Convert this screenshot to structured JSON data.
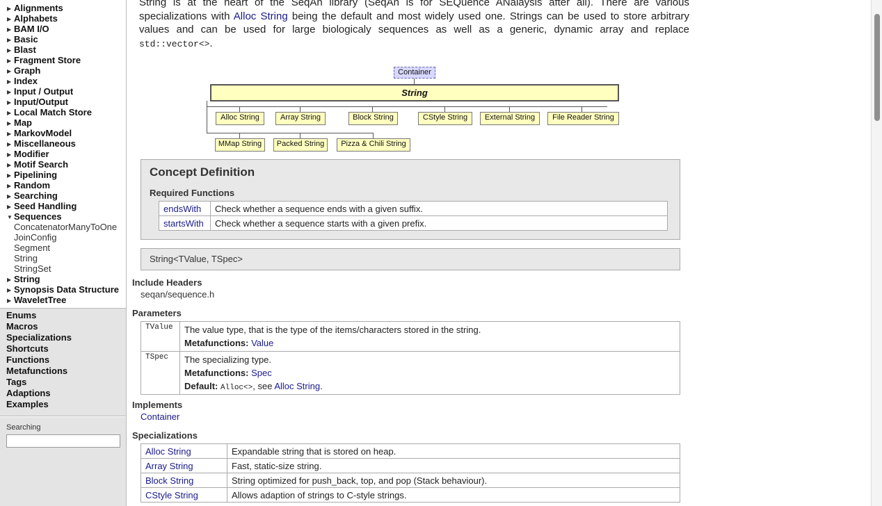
{
  "sidebar": {
    "tree": [
      {
        "label": "Alignments",
        "type": "group"
      },
      {
        "label": "Alphabets",
        "type": "group"
      },
      {
        "label": "BAM I/O",
        "type": "group"
      },
      {
        "label": "Basic",
        "type": "group"
      },
      {
        "label": "Blast",
        "type": "group"
      },
      {
        "label": "Fragment Store",
        "type": "group"
      },
      {
        "label": "Graph",
        "type": "group"
      },
      {
        "label": "Index",
        "type": "group"
      },
      {
        "label": "Input / Output",
        "type": "group"
      },
      {
        "label": "Input/Output",
        "type": "group"
      },
      {
        "label": "Local Match Store",
        "type": "group"
      },
      {
        "label": "Map",
        "type": "group"
      },
      {
        "label": "MarkovModel",
        "type": "group"
      },
      {
        "label": "Miscellaneous",
        "type": "group"
      },
      {
        "label": "Modifier",
        "type": "group"
      },
      {
        "label": "Motif Search",
        "type": "group"
      },
      {
        "label": "Pipelining",
        "type": "group"
      },
      {
        "label": "Random",
        "type": "group"
      },
      {
        "label": "Searching",
        "type": "group"
      },
      {
        "label": "Seed Handling",
        "type": "group"
      },
      {
        "label": "Sequences",
        "type": "group-open"
      },
      {
        "label": "ConcatenatorManyToOne",
        "type": "sub"
      },
      {
        "label": "JoinConfig",
        "type": "sub"
      },
      {
        "label": "Segment",
        "type": "sub"
      },
      {
        "label": "String",
        "type": "sub"
      },
      {
        "label": "StringSet",
        "type": "sub"
      },
      {
        "label": "String",
        "type": "group"
      },
      {
        "label": "Synopsis Data Structure",
        "type": "group"
      },
      {
        "label": "WaveletTree",
        "type": "group"
      }
    ],
    "categories": [
      "Enums",
      "Macros",
      "Specializations",
      "Shortcuts",
      "Functions",
      "Metafunctions",
      "Tags",
      "Adaptions",
      "Examples"
    ],
    "search": {
      "label": "Searching",
      "value": ""
    }
  },
  "intro": {
    "p1": "String is at the heart of the SeqAn library (SeqAn is for SEQuence ANalaysis after all). There are various specializations with ",
    "link": "Alloc String",
    "p2": " being the default and most widely used one. Strings can be used to store arbitrary values and can be used for large biologicaly sequences as well as a generic, dynamic array and replace ",
    "code": "std::vector<>",
    "p3": "."
  },
  "diagram": {
    "container": "Container",
    "root": "String",
    "row1": [
      "Alloc String",
      "Array String",
      "Block String",
      "CStyle String",
      "External String",
      "File Reader String"
    ],
    "row2": [
      "MMap String",
      "Packed String",
      "Pizza & Chili String"
    ]
  },
  "concept": {
    "title": "Concept Definition",
    "required_title": "Required Functions",
    "functions": [
      {
        "name": "endsWith",
        "desc": "Check whether a sequence ends with a given suffix."
      },
      {
        "name": "startsWith",
        "desc": "Check whether a sequence starts with a given prefix."
      }
    ]
  },
  "signature": "String<TValue, TSpec>",
  "include": {
    "title": "Include Headers",
    "value": "seqan/sequence.h"
  },
  "parameters": {
    "title": "Parameters",
    "items": [
      {
        "name": "TValue",
        "desc": "The value type, that is the type of the items/characters stored in the string.",
        "meta_label": "Metafunctions:",
        "meta_value": "Value"
      },
      {
        "name": "TSpec",
        "desc": "The specializing type.",
        "meta_label": "Metafunctions:",
        "meta_value": "Spec",
        "default_label": "Default:",
        "default_code": "Alloc<>",
        "default_mid": ", see ",
        "default_link": "Alloc String",
        "default_end": "."
      }
    ]
  },
  "implements": {
    "title": "Implements",
    "value": "Container"
  },
  "specializations": {
    "title": "Specializations",
    "rows": [
      {
        "name": "Alloc String",
        "desc": "Expandable string that is stored on heap."
      },
      {
        "name": "Array String",
        "desc": "Fast, static-size string."
      },
      {
        "name": "Block String",
        "desc": "String optimized for push_back, top, and pop (Stack behaviour)."
      },
      {
        "name": "CStyle String",
        "desc": "Allows adaption of strings to C-style strings."
      }
    ]
  }
}
